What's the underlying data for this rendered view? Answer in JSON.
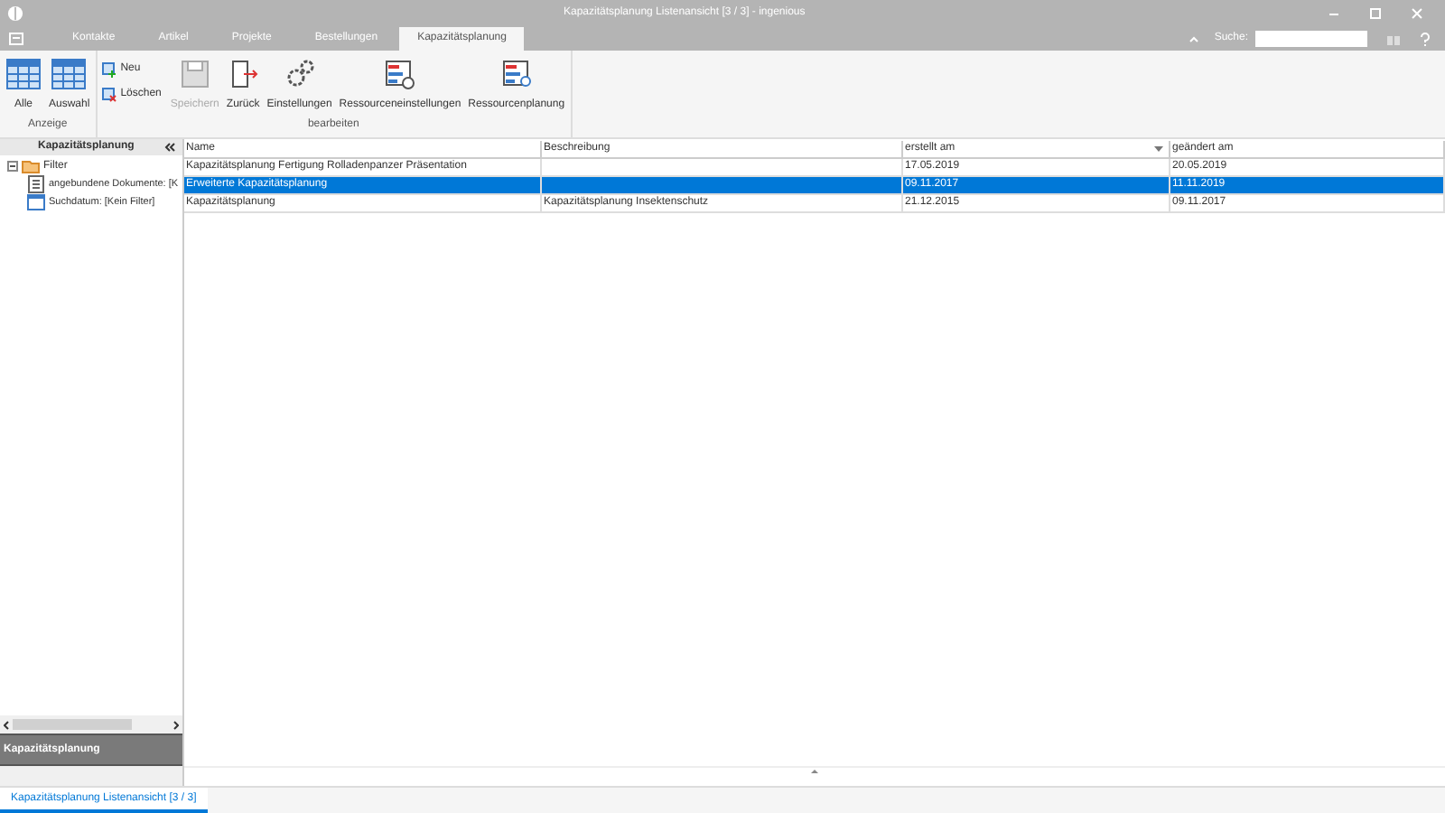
{
  "window": {
    "title": "Kapazitätsplanung Listenansicht [3 / 3] - ingenious"
  },
  "tabs": [
    {
      "label": "Kontakte",
      "selected": false
    },
    {
      "label": "Artikel",
      "selected": false
    },
    {
      "label": "Projekte",
      "selected": false
    },
    {
      "label": "Bestellungen",
      "selected": false
    },
    {
      "label": "Kapazitätsplanung",
      "selected": true
    }
  ],
  "search": {
    "label": "Suche:"
  },
  "ribbon": {
    "groups": [
      {
        "label": "Anzeige",
        "buttons": [
          {
            "label": "Alle",
            "disabled": false
          },
          {
            "label": "Auswahl",
            "disabled": false
          }
        ]
      },
      {
        "label": "bearbeiten",
        "small": [
          {
            "label": "Neu"
          },
          {
            "label": "Löschen"
          }
        ],
        "buttons": [
          {
            "label": "Speichern",
            "disabled": true
          },
          {
            "label": "Zurück",
            "disabled": false
          },
          {
            "label": "Einstellungen",
            "disabled": false
          },
          {
            "label": "Ressourceneinstellungen",
            "disabled": false
          },
          {
            "label": "Ressourcenplanung",
            "disabled": false
          }
        ]
      }
    ]
  },
  "sidebar": {
    "title": "Kapazitätsplanung",
    "tree": [
      {
        "label": "Filter",
        "expanded": true,
        "children": [
          {
            "label": "angebundene Dokumente: [K"
          },
          {
            "label": "Suchdatum: [Kein Filter]"
          }
        ]
      }
    ],
    "footer": "Kapazitätsplanung"
  },
  "table": {
    "columns": [
      "Name",
      "Beschreibung",
      "erstellt am",
      "geändert am"
    ],
    "rows": [
      {
        "cells": [
          "Kapazitätsplanung Fertigung Rolladenpanzer Präsentation",
          "",
          "17.05.2019",
          "20.05.2019"
        ],
        "selected": false
      },
      {
        "cells": [
          "Erweiterte Kapazitätsplanung",
          "",
          "09.11.2017",
          "11.11.2019"
        ],
        "selected": true
      },
      {
        "cells": [
          "Kapazitätsplanung",
          "Kapazitätsplanung Insektenschutz",
          "21.12.2015",
          "09.11.2017"
        ],
        "selected": false
      }
    ]
  },
  "status_tab": "Kapazitätsplanung Listenansicht [3 / 3]"
}
